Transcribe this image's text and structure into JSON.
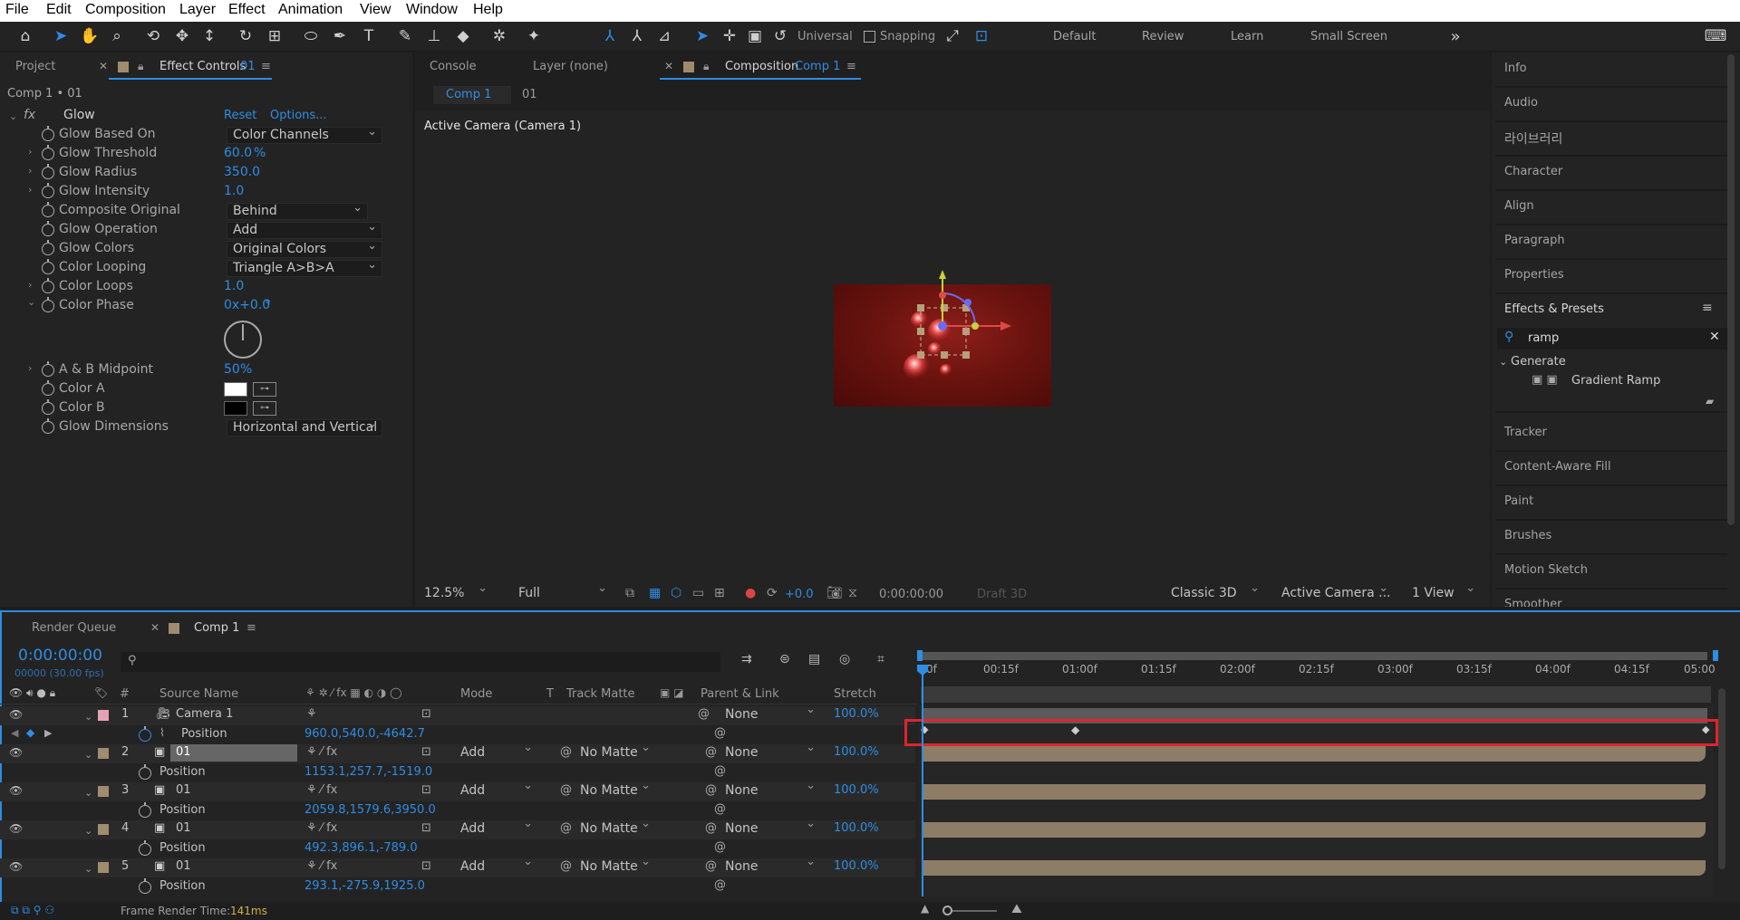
{
  "menu": [
    "File",
    "Edit",
    "Composition",
    "Layer",
    "Effect",
    "Animation",
    "View",
    "Window",
    "Help"
  ],
  "toolbar": {
    "universal_label": "Universal",
    "snapping_label": "Snapping",
    "workspaces": [
      "Default",
      "Review",
      "Learn",
      "Small Screen"
    ]
  },
  "left_panel": {
    "tabs": {
      "project": "Project",
      "effect_controls": "Effect Controls",
      "effect_controls_target": "01"
    },
    "comp_path": "Comp 1 • 01",
    "effect": {
      "name": "Glow",
      "reset": "Reset",
      "options": "Options..."
    },
    "props": {
      "glow_based_on": {
        "label": "Glow Based On",
        "value": "Color Channels"
      },
      "glow_threshold": {
        "label": "Glow Threshold",
        "value": "60.0",
        "unit": "%"
      },
      "glow_radius": {
        "label": "Glow Radius",
        "value": "350.0"
      },
      "glow_intensity": {
        "label": "Glow Intensity",
        "value": "1.0"
      },
      "composite_original": {
        "label": "Composite Original",
        "value": "Behind"
      },
      "glow_operation": {
        "label": "Glow Operation",
        "value": "Add"
      },
      "glow_colors": {
        "label": "Glow Colors",
        "value": "Original Colors"
      },
      "color_looping": {
        "label": "Color Looping",
        "value": "Triangle A>B>A"
      },
      "color_loops": {
        "label": "Color Loops",
        "value": "1.0"
      },
      "color_phase": {
        "label": "Color Phase",
        "value": "0x+0.0",
        "unit": "°"
      },
      "ab_midpoint": {
        "label": "A & B Midpoint",
        "value": "50",
        "unit": "%"
      },
      "color_a": {
        "label": "Color A",
        "color": "#ffffff"
      },
      "color_b": {
        "label": "Color B",
        "color": "#000000"
      },
      "glow_dimensions": {
        "label": "Glow Dimensions",
        "value": "Horizontal and Vertical"
      }
    }
  },
  "viewer": {
    "tabs": {
      "console": "Console",
      "layer": "Layer (none)",
      "composition": "Composition",
      "composition_target": "Comp 1"
    },
    "breadcrumb": {
      "comp": "Comp 1",
      "layer": "01"
    },
    "camera_label": "Active Camera (Camera 1)",
    "footer": {
      "zoom": "12.5%",
      "resolution": "Full",
      "exposure": "+0.0",
      "timecode": "0:00:00:00",
      "draft": "Draft 3D",
      "renderer": "Classic 3D",
      "camera": "Active Camera ...",
      "views": "1 View"
    }
  },
  "right_panel": {
    "items_top": [
      "Info",
      "Audio",
      "라이브러리",
      "Character",
      "Align",
      "Paragraph",
      "Properties"
    ],
    "effects_presets": {
      "title": "Effects & Presets",
      "search": "ramp",
      "category": "Generate",
      "item": "Gradient Ramp"
    },
    "items_bottom": [
      "Tracker",
      "Content-Aware Fill",
      "Paint",
      "Brushes",
      "Motion Sketch",
      "Smoother"
    ]
  },
  "timeline": {
    "tabs": {
      "render_queue": "Render Queue",
      "comp": "Comp 1"
    },
    "timecode": "0:00:00:00",
    "frame_info": "00000 (30.00 fps)",
    "columns": {
      "num": "#",
      "source": "Source Name",
      "mode": "Mode",
      "t": "T",
      "track_matte": "Track Matte",
      "parent": "Parent & Link",
      "stretch": "Stretch"
    },
    "ruler": [
      "0f",
      "00:15f",
      "01:00f",
      "01:15f",
      "02:00f",
      "02:15f",
      "03:00f",
      "03:15f",
      "04:00f",
      "04:15f",
      "05:00"
    ],
    "layers": [
      {
        "num": "1",
        "name": "Camera 1",
        "parent": "None",
        "stretch": "100.0%",
        "prop": "Position",
        "prop_value": "960.0,540.0,-4642.7",
        "label_color": "#e6a0b4"
      },
      {
        "num": "2",
        "name": "01",
        "mode": "Add",
        "matte": "No Matte",
        "parent": "None",
        "stretch": "100.0%",
        "prop": "Position",
        "prop_value": "1153.1,257.7,-1519.0",
        "label_color": "#a08c6e"
      },
      {
        "num": "3",
        "name": "01",
        "mode": "Add",
        "matte": "No Matte",
        "parent": "None",
        "stretch": "100.0%",
        "prop": "Position",
        "prop_value": "2059.8,1579.6,3950.0",
        "label_color": "#a08c6e"
      },
      {
        "num": "4",
        "name": "01",
        "mode": "Add",
        "matte": "No Matte",
        "parent": "None",
        "stretch": "100.0%",
        "prop": "Position",
        "prop_value": "492.3,896.1,-789.0",
        "label_color": "#a08c6e"
      },
      {
        "num": "5",
        "name": "01",
        "mode": "Add",
        "matte": "No Matte",
        "parent": "None",
        "stretch": "100.0%",
        "prop": "Position",
        "prop_value": "293.1,-275.9,1925.0",
        "label_color": "#a08c6e"
      }
    ],
    "status": {
      "label": "Frame Render Time:",
      "value": "141ms"
    }
  }
}
